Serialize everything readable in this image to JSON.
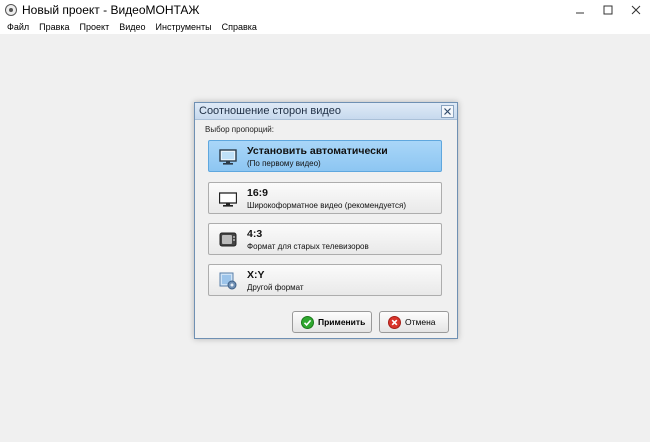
{
  "window": {
    "title": "Новый проект - ВидеоМОНТАЖ"
  },
  "menu": [
    {
      "label": "Файл"
    },
    {
      "label": "Правка"
    },
    {
      "label": "Проект"
    },
    {
      "label": "Видео"
    },
    {
      "label": "Инструменты"
    },
    {
      "label": "Справка"
    }
  ],
  "dialog": {
    "title": "Соотношение сторон видео",
    "group_label": "Выбор пропорций:",
    "options": [
      {
        "title": "Установить автоматически",
        "subtitle": "(По первому видео)",
        "icon": "monitor-auto-icon",
        "selected": true
      },
      {
        "title": "16:9",
        "subtitle": "Широкоформатное видео (рекомендуется)",
        "icon": "widescreen-monitor-icon",
        "selected": false
      },
      {
        "title": "4:3",
        "subtitle": "Формат для старых телевизоров",
        "icon": "old-tv-icon",
        "selected": false
      },
      {
        "title": "X:Y",
        "subtitle": "Другой формат",
        "icon": "custom-ratio-icon",
        "selected": false
      }
    ],
    "apply_label": "Применить",
    "cancel_label": "Отмена"
  },
  "colors": {
    "selected_bg": "#8dc6f2",
    "dialog_border": "#6f90b3",
    "apply_icon": "#2fa82f",
    "cancel_icon": "#d9342b"
  }
}
